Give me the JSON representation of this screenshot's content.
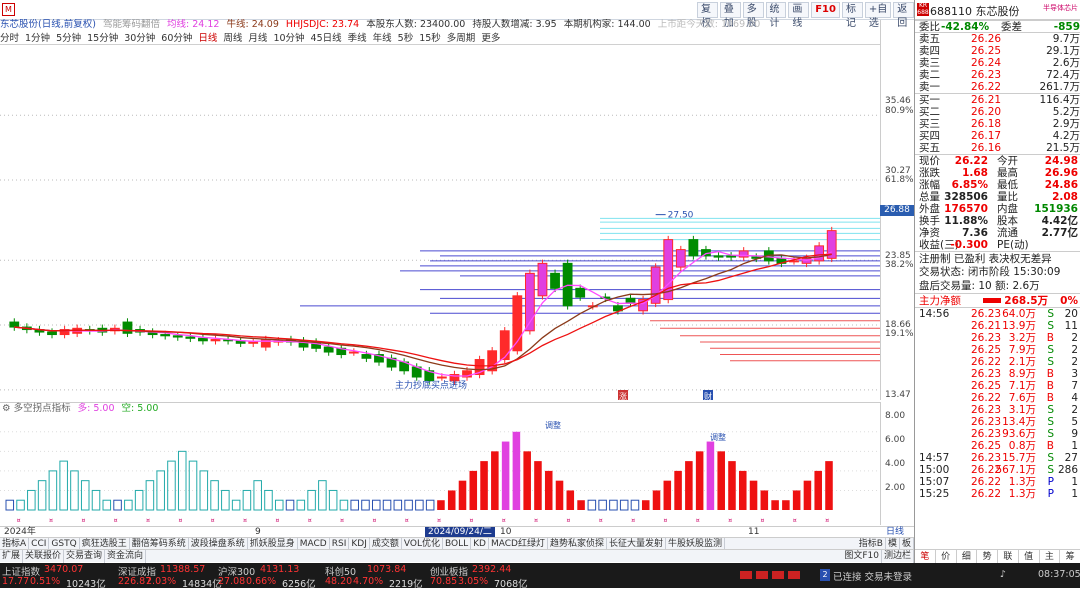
{
  "toolbar": {
    "logo": "M",
    "period_tabs": [
      "分时",
      "1分钟",
      "5分钟",
      "15分钟",
      "30分钟",
      "60分钟",
      "日线",
      "周线",
      "月线",
      "10分钟",
      "45日线",
      "季线",
      "年线",
      "5秒",
      "15秒",
      "多周期",
      "更多"
    ],
    "active_period": "日线",
    "buttons": [
      "复权",
      "叠加",
      "多股",
      "统计",
      "画线",
      "F10",
      "标记",
      "+自选",
      "返回"
    ]
  },
  "legend": {
    "stock": "东芯股份(日线,前复权)",
    "item1": "驾能筹码翻倍",
    "avg": "均线: 24.12",
    "cow": "牛线: 24.09",
    "hhj": "HHJSDJC: 23.74",
    "holders": "本股东人数: 23400.00",
    "hold_change": "持股人数增减: 3.95",
    "inst": "本期机构家: 144.00",
    "days": "上市距今天数: 1069.00"
  },
  "colors": {
    "up": "#ff2a2a",
    "down": "#008b00",
    "ma1": "#ff4aff",
    "ma2": "#8b3a1a",
    "ma3": "#ee1111"
  },
  "price_axis": {
    "labels": [
      "35.46",
      "80.9%",
      "30.27",
      "61.8%",
      "23.85",
      "38.2%",
      "18.66",
      "19.1%",
      "13.47"
    ],
    "current": "26.88"
  },
  "annotations": {
    "high": "27.50",
    "low_text": "主力抄底买点进场",
    "marker1": "涨",
    "marker2": "财"
  },
  "indicator": {
    "name": "多空拐点指标",
    "duo": "多: 5.00",
    "kong": "空: 5.00",
    "note1": "调整",
    "note2": "调整",
    "axis": [
      "8.00",
      "6.00",
      "4.00",
      "2.00"
    ]
  },
  "dates": {
    "d2024": "2024年",
    "d9": "9",
    "hl": "2024/09/24/二",
    "d10": "10",
    "d11": "11",
    "right": "日线"
  },
  "tabs_row1": [
    "指标A",
    "CCI",
    "GSTQ",
    "疯狂选股王",
    "翻倍筹码系统",
    "波段操盘系统",
    "抓妖股显身",
    "MACD",
    "RSI",
    "KDJ",
    "成交额",
    "VOL优化",
    "BOLL",
    "KD",
    "MACD红绿灯",
    "趋势私家侦探",
    "长征大量发射",
    "牛股妖股监测"
  ],
  "tabs_row1_right": [
    "指标B",
    "模",
    "板"
  ],
  "tabs_row2": [
    "扩展",
    "关联报价",
    "交易查询",
    "资金流向"
  ],
  "tabs_row2_right": [
    "图文F10",
    "测边栏"
  ],
  "status": {
    "items": [
      {
        "name": "上证指数",
        "value": "3470.07",
        "chg": "17.77",
        "pct": "0.51%",
        "amt": "10243亿"
      },
      {
        "name": "深证成指",
        "value": "11388.57",
        "chg": "226.87",
        "pct": "2.03%",
        "amt": "14834亿"
      },
      {
        "name": "沪深300",
        "value": "4131.13",
        "chg": "27.08",
        "pct": "0.66%",
        "amt": "6256亿"
      },
      {
        "name": "科创50",
        "value": "1073.84",
        "chg": "48.20",
        "pct": "4.70%",
        "amt": "2219亿"
      },
      {
        "name": "创业板指",
        "value": "2392.44",
        "chg": "70.85",
        "pct": "3.05%",
        "amt": "7068亿"
      }
    ],
    "conn": "已连接 交易未登录",
    "time": "08:37:05"
  },
  "panel": {
    "code": "688110",
    "name": "东芯股份",
    "sub": "半导体芯片",
    "kr": "KR 688",
    "weibi_label": "委比",
    "weibi": "-42.84%",
    "weicha_label": "委差",
    "weicha": "-859",
    "asks": [
      {
        "label": "卖五",
        "price": "26.26",
        "vol": "9.7万"
      },
      {
        "label": "卖四",
        "price": "26.25",
        "vol": "29.1万"
      },
      {
        "label": "卖三",
        "price": "26.24",
        "vol": "2.6万"
      },
      {
        "label": "卖二",
        "price": "26.23",
        "vol": "72.4万"
      },
      {
        "label": "卖一",
        "price": "26.22",
        "vol": "261.7万"
      }
    ],
    "bids": [
      {
        "label": "买一",
        "price": "26.21",
        "vol": "116.4万"
      },
      {
        "label": "买二",
        "price": "26.20",
        "vol": "5.2万"
      },
      {
        "label": "买三",
        "price": "26.18",
        "vol": "2.9万"
      },
      {
        "label": "买四",
        "price": "26.17",
        "vol": "4.2万"
      },
      {
        "label": "买五",
        "price": "26.16",
        "vol": "21.5万"
      }
    ],
    "stats": [
      [
        "现价",
        "26.22",
        "今开",
        "24.98"
      ],
      [
        "涨跌",
        "1.68",
        "最高",
        "26.96"
      ],
      [
        "涨幅",
        "6.85%",
        "最低",
        "24.86"
      ],
      [
        "总量",
        "328506",
        "量比",
        "2.08"
      ],
      [
        "外盘",
        "176570",
        "内盘",
        "151936"
      ],
      [
        "换手",
        "11.88%",
        "股本",
        "4.42亿"
      ],
      [
        "净资",
        "7.36",
        "流通",
        "2.77亿"
      ],
      [
        "收益(三)",
        "-0.300",
        "PE(动)",
        ""
      ]
    ],
    "zhuce": "注册制 已盈利 表决权无差异",
    "trade_state": "交易状态: 闭市阶段 15:30:09",
    "after": "盘后交易量: 10  额: 2.6万",
    "zljm_label": "主力净额",
    "zljm": "268.5万",
    "zljm_pct": "0%",
    "ticks": [
      {
        "time": "14:56",
        "price": "26.23",
        "vol": "64.0万",
        "bs": "S",
        "n": "20"
      },
      {
        "time": "",
        "price": "26.21",
        "vol": "13.9万",
        "bs": "S",
        "n": "11"
      },
      {
        "time": "",
        "price": "26.23",
        "vol": "3.2万",
        "bs": "B",
        "n": "2"
      },
      {
        "time": "",
        "price": "26.25",
        "vol": "7.9万",
        "bs": "S",
        "n": "2"
      },
      {
        "time": "",
        "price": "26.22",
        "vol": "2.1万",
        "bs": "S",
        "n": "2"
      },
      {
        "time": "",
        "price": "26.23",
        "vol": "8.9万",
        "bs": "B",
        "n": "3"
      },
      {
        "time": "",
        "price": "26.25",
        "vol": "7.1万",
        "bs": "B",
        "n": "7"
      },
      {
        "time": "",
        "price": "26.22",
        "vol": "7.6万",
        "bs": "B",
        "n": "4"
      },
      {
        "time": "",
        "price": "26.23",
        "vol": "3.1万",
        "bs": "S",
        "n": "2"
      },
      {
        "time": "",
        "price": "26.23",
        "vol": "13.4万",
        "bs": "S",
        "n": "5"
      },
      {
        "time": "",
        "price": "26.23",
        "vol": "93.6万",
        "bs": "S",
        "n": "9"
      },
      {
        "time": "",
        "price": "26.25",
        "vol": "0.8万",
        "bs": "B",
        "n": "1"
      },
      {
        "time": "14:57",
        "price": "26.23",
        "vol": "15.7万",
        "bs": "S",
        "n": "27"
      },
      {
        "time": "15:00",
        "price": "26.22",
        "vol": "567.1万",
        "bs": "S",
        "n": "286"
      },
      {
        "time": "15:07",
        "price": "26.22",
        "vol": "1.3万",
        "bs": "P",
        "n": "1"
      },
      {
        "time": "15:25",
        "price": "26.22",
        "vol": "1.3万",
        "bs": "P",
        "n": "1"
      }
    ],
    "bottom_tabs": [
      "笔",
      "价",
      "细",
      "势",
      "联",
      "值",
      "主",
      "筹"
    ]
  },
  "chart_data": [
    {
      "type": "candlestick",
      "title": "东芯股份(日线,前复权)",
      "ylim": [
        12.5,
        41
      ],
      "x": [
        "2024-07-29",
        "2024-07-30",
        "2024-07-31",
        "2024-08-01",
        "2024-08-02",
        "2024-08-05",
        "2024-08-06",
        "2024-08-07",
        "2024-08-08",
        "2024-08-09",
        "2024-08-12",
        "2024-08-13",
        "2024-08-14",
        "2024-08-15",
        "2024-08-16",
        "2024-08-19",
        "2024-08-20",
        "2024-08-21",
        "2024-08-22",
        "2024-08-23",
        "2024-08-26",
        "2024-08-27",
        "2024-08-28",
        "2024-08-29",
        "2024-08-30",
        "2024-09-02",
        "2024-09-03",
        "2024-09-04",
        "2024-09-05",
        "2024-09-06",
        "2024-09-09",
        "2024-09-10",
        "2024-09-11",
        "2024-09-12",
        "2024-09-13",
        "2024-09-18",
        "2024-09-19",
        "2024-09-20",
        "2024-09-23",
        "2024-09-24",
        "2024-09-25",
        "2024-09-26",
        "2024-09-27",
        "2024-09-30",
        "2024-10-08",
        "2024-10-09",
        "2024-10-10",
        "2024-10-11",
        "2024-10-14",
        "2024-10-15",
        "2024-10-16",
        "2024-10-17",
        "2024-10-18",
        "2024-10-21",
        "2024-10-22",
        "2024-10-23",
        "2024-10-24",
        "2024-10-25",
        "2024-10-28",
        "2024-10-29",
        "2024-10-30",
        "2024-10-31",
        "2024-11-01",
        "2024-11-04"
      ],
      "open": [
        18.9,
        18.5,
        18.3,
        18.1,
        17.9,
        18.0,
        18.3,
        18.4,
        18.2,
        18.9,
        18.3,
        18.1,
        17.9,
        17.8,
        17.7,
        17.6,
        17.4,
        17.5,
        17.4,
        17.2,
        16.9,
        17.3,
        17.5,
        17.4,
        17.3,
        16.9,
        16.8,
        16.5,
        16.3,
        16.3,
        16.0,
        15.7,
        15.3,
        15.0,
        14.5,
        14.2,
        14.5,
        14.7,
        15.0,
        15.9,
        16.6,
        18.2,
        21.0,
        22.8,
        23.6,
        21.6,
        20.2,
        20.9,
        20.2,
        20.8,
        19.8,
        20.4,
        20.7,
        23.3,
        25.5,
        24.7,
        24.2,
        24.2,
        24.1,
        24.1,
        24.6,
        24.0,
        23.8,
        23.6,
        23.8,
        24.0,
        25.0
      ],
      "close": [
        18.5,
        18.3,
        18.1,
        17.9,
        18.3,
        18.4,
        18.2,
        18.1,
        18.4,
        18.0,
        18.1,
        17.9,
        17.8,
        17.7,
        17.6,
        17.4,
        17.5,
        17.4,
        17.2,
        17.3,
        17.5,
        17.4,
        17.3,
        16.9,
        16.8,
        16.5,
        16.3,
        16.5,
        16.0,
        15.7,
        15.3,
        15.0,
        14.5,
        14.2,
        14.5,
        14.7,
        15.0,
        15.9,
        16.6,
        18.2,
        21.0,
        22.8,
        23.6,
        21.6,
        20.2,
        20.9,
        20.2,
        20.8,
        19.8,
        20.4,
        20.7,
        23.3,
        25.5,
        24.7,
        24.2,
        24.2,
        24.1,
        24.1,
        24.6,
        24.0,
        23.8,
        23.6,
        23.8,
        24.0,
        25.0,
        26.22
      ],
      "ma": [
        {
          "name": "均线",
          "value": 24.12
        },
        {
          "name": "牛线",
          "value": 24.09
        },
        {
          "name": "HHJSDJC",
          "value": 23.74
        }
      ],
      "high_mark": 27.5,
      "fib_levels": [
        35.46,
        30.27,
        23.85,
        18.66,
        13.47
      ]
    },
    {
      "type": "bar",
      "title": "多空拐点指标",
      "ylim": [
        0,
        9
      ],
      "series": [
        {
          "name": "多",
          "values": [
            0,
            0,
            0,
            0,
            0,
            0,
            0,
            0,
            0,
            0,
            0,
            0,
            0,
            0,
            0,
            0,
            0,
            0,
            0,
            0,
            0,
            0,
            0,
            0,
            0,
            0,
            0,
            0,
            0,
            0,
            0,
            0,
            0,
            0,
            0,
            0,
            0,
            0,
            0,
            0,
            1,
            2,
            3,
            4,
            5,
            6,
            7,
            8,
            6,
            5,
            4,
            3,
            2,
            1,
            0,
            0,
            0,
            0,
            0,
            1,
            2,
            3,
            4,
            5,
            6,
            7,
            6,
            5,
            4,
            3,
            2,
            1,
            1,
            2,
            3,
            4,
            5
          ]
        },
        {
          "name": "空",
          "values": [
            0,
            1,
            2,
            3,
            4,
            5,
            4,
            3,
            2,
            1,
            0,
            1,
            2,
            3,
            4,
            5,
            6,
            5,
            4,
            3,
            2,
            1,
            2,
            3,
            2,
            1,
            0,
            1,
            2,
            3,
            2,
            1,
            0,
            0,
            0,
            0,
            0,
            0,
            0,
            0,
            0,
            0,
            0,
            0,
            0,
            0,
            0,
            0,
            0,
            0,
            0,
            0,
            0,
            0,
            0,
            0,
            0,
            0,
            0,
            0,
            0,
            0,
            0,
            0,
            0,
            0,
            0,
            0,
            0,
            0,
            0,
            0,
            0,
            0,
            0,
            0,
            0
          ]
        }
      ]
    }
  ]
}
